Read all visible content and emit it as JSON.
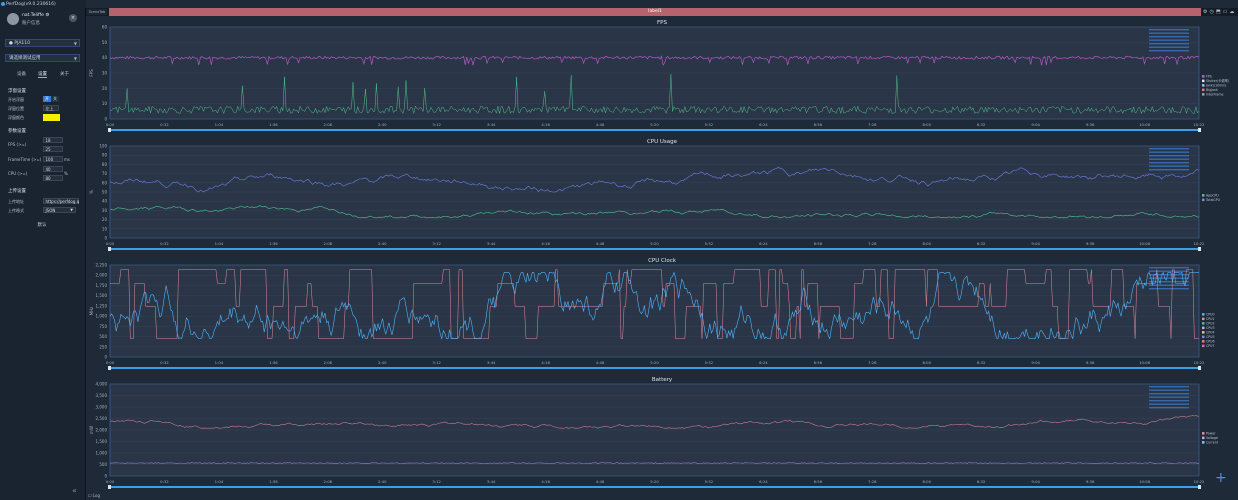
{
  "app": {
    "title": "PerfDog(v9.0.230616)"
  },
  "user": {
    "name": "nat.Teliffe ⚙",
    "status": "账户信息"
  },
  "device": {
    "selected": "● PJA110"
  },
  "app_select": {
    "placeholder": "请选择测试应用"
  },
  "tabs": [
    {
      "label": "设备"
    },
    {
      "label": "设置"
    },
    {
      "label": "关于"
    }
  ],
  "settings": {
    "float_title": "浮窗设置",
    "float_toggle_label": "开启浮窗",
    "float_on": "开",
    "float_off": "关",
    "float_pos_label": "浮窗位置",
    "float_pos_value": "左上",
    "float_color_label": "浮窗颜色",
    "float_color": "#f5ee00",
    "param_title": "参数设置",
    "fps_label": "FPS (>=)",
    "fps_value1": "18",
    "fps_value2": "25",
    "frametime_label": "FrameTime (>=)",
    "frametime_value": "100",
    "frametime_unit": "ms",
    "cpu_label": "CPU (>=)",
    "cpu_value1": "40",
    "cpu_value2": "80",
    "cpu_unit": "%",
    "upload_title": "上传设置",
    "upload_addr_label": "上传地址",
    "upload_addr_value": "https://perfdog.q",
    "upload_fmt_label": "上传格式",
    "upload_fmt_value": "JSON",
    "default_button": "默认"
  },
  "main": {
    "scene_tab": "SceneTab",
    "label_bar": "label1",
    "log_label": "Log"
  },
  "time_ticks": [
    "0:00",
    "0:32",
    "1:04",
    "1:36",
    "2:08",
    "2:40",
    "3:12",
    "3:44",
    "4:16",
    "4:48",
    "5:20",
    "5:52",
    "6:24",
    "6:56",
    "7:28",
    "8:00",
    "8:32",
    "9:04",
    "9:36",
    "10:08",
    "10:22"
  ],
  "charts": [
    {
      "title": "FPS",
      "ylabel": "FPS",
      "yticks": [
        "60",
        "50",
        "40",
        "30",
        "20",
        "10",
        "0"
      ],
      "legend": [
        "FPS",
        "Stutter(卡顿率)",
        "Jank(/10min)",
        "BigJank",
        "InterFrame"
      ],
      "legend_colors": [
        "#c45bd1",
        "#e3e3e3",
        "#7ec9ff",
        "#ff6f6f",
        "#a0a0a0"
      ]
    },
    {
      "title": "CPU Usage",
      "ylabel": "%",
      "yticks": [
        "100",
        "90",
        "80",
        "70",
        "60",
        "50",
        "40",
        "30",
        "20",
        "10",
        "0"
      ],
      "legend": [
        "AppCPU",
        "TotalCPU"
      ],
      "legend_colors": [
        "#4fc48b",
        "#7b89e0"
      ]
    },
    {
      "title": "CPU Clock",
      "ylabel": "MHz",
      "yticks": [
        "2,250",
        "2,000",
        "1,750",
        "1,500",
        "1,250",
        "1,000",
        "750",
        "500",
        "250",
        "0"
      ],
      "legend": [
        "CPU0",
        "CPU1",
        "CPU2",
        "CPU3",
        "CPU4",
        "CPU5",
        "CPU6",
        "CPU7"
      ],
      "legend_colors": [
        "#4db6ff",
        "#e88c9a",
        "#4fc48b",
        "#c5a4ff",
        "#f0c36a",
        "#7b89e0",
        "#ff7a6a",
        "#d968c3"
      ]
    },
    {
      "title": "Battery",
      "ylabel": "mW",
      "yticks": [
        "4,000",
        "3,500",
        "3,000",
        "2,500",
        "2,000",
        "1,500",
        "1,000",
        "500",
        "0"
      ],
      "legend": [
        "Power",
        "Voltage",
        "Current"
      ],
      "legend_colors": [
        "#e88c9a",
        "#c5a4ff",
        "#7ec9ff"
      ]
    }
  ],
  "colors": {
    "fps_line": "#c45bd1",
    "stutter_line": "#4fc48b",
    "cpu_total": "#6f7fe0",
    "cpu_app": "#4fc48b",
    "clock_big": "#e88c9a",
    "clock_little": "#4db6ff",
    "battery_power": "#c77d8c",
    "battery_current": "#9b7fcf",
    "plot_bg": "#2a3648",
    "grid": "#3a4658",
    "timeline": "#3aa0e8"
  }
}
